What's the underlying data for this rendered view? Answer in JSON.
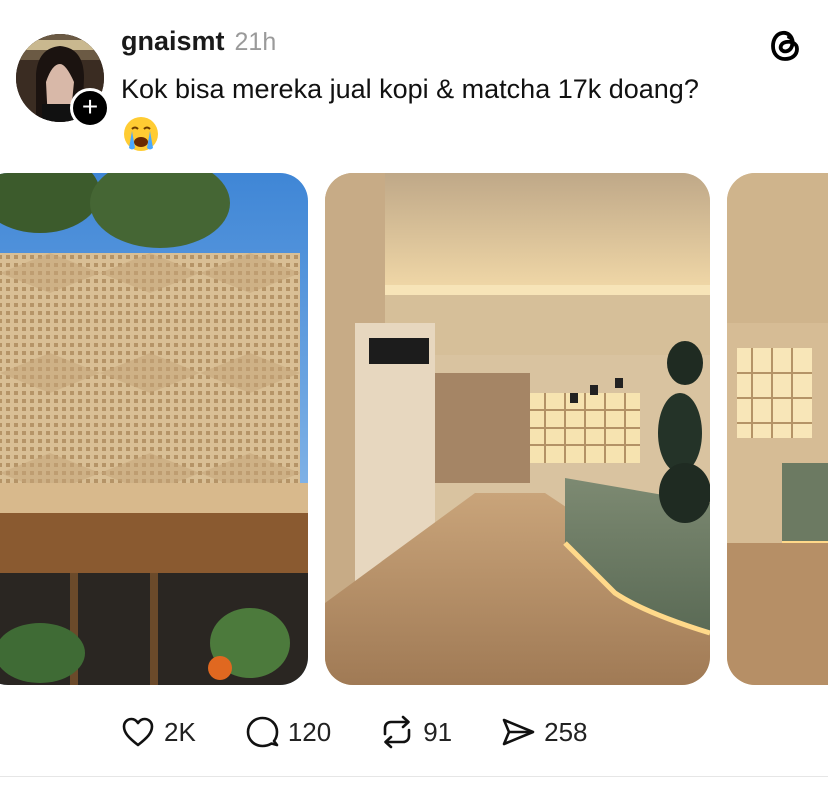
{
  "post": {
    "username": "gnaismt",
    "time": "21h",
    "text": "Kok bisa mereka jual kopi & matcha 17k doang?",
    "emoji": "crying-face-emoji"
  },
  "images": [
    {
      "name": "building-facade-photo"
    },
    {
      "name": "cafe-interior-photo"
    },
    {
      "name": "cafe-interior-photo-partial"
    }
  ],
  "actions": {
    "likes": "2K",
    "replies": "120",
    "reposts": "91",
    "shares": "258"
  },
  "icons": {
    "like": "heart-icon",
    "reply": "speech-bubble-icon",
    "repost": "repost-icon",
    "share": "send-icon",
    "logo": "threads-logo-icon",
    "follow": "plus-icon"
  }
}
